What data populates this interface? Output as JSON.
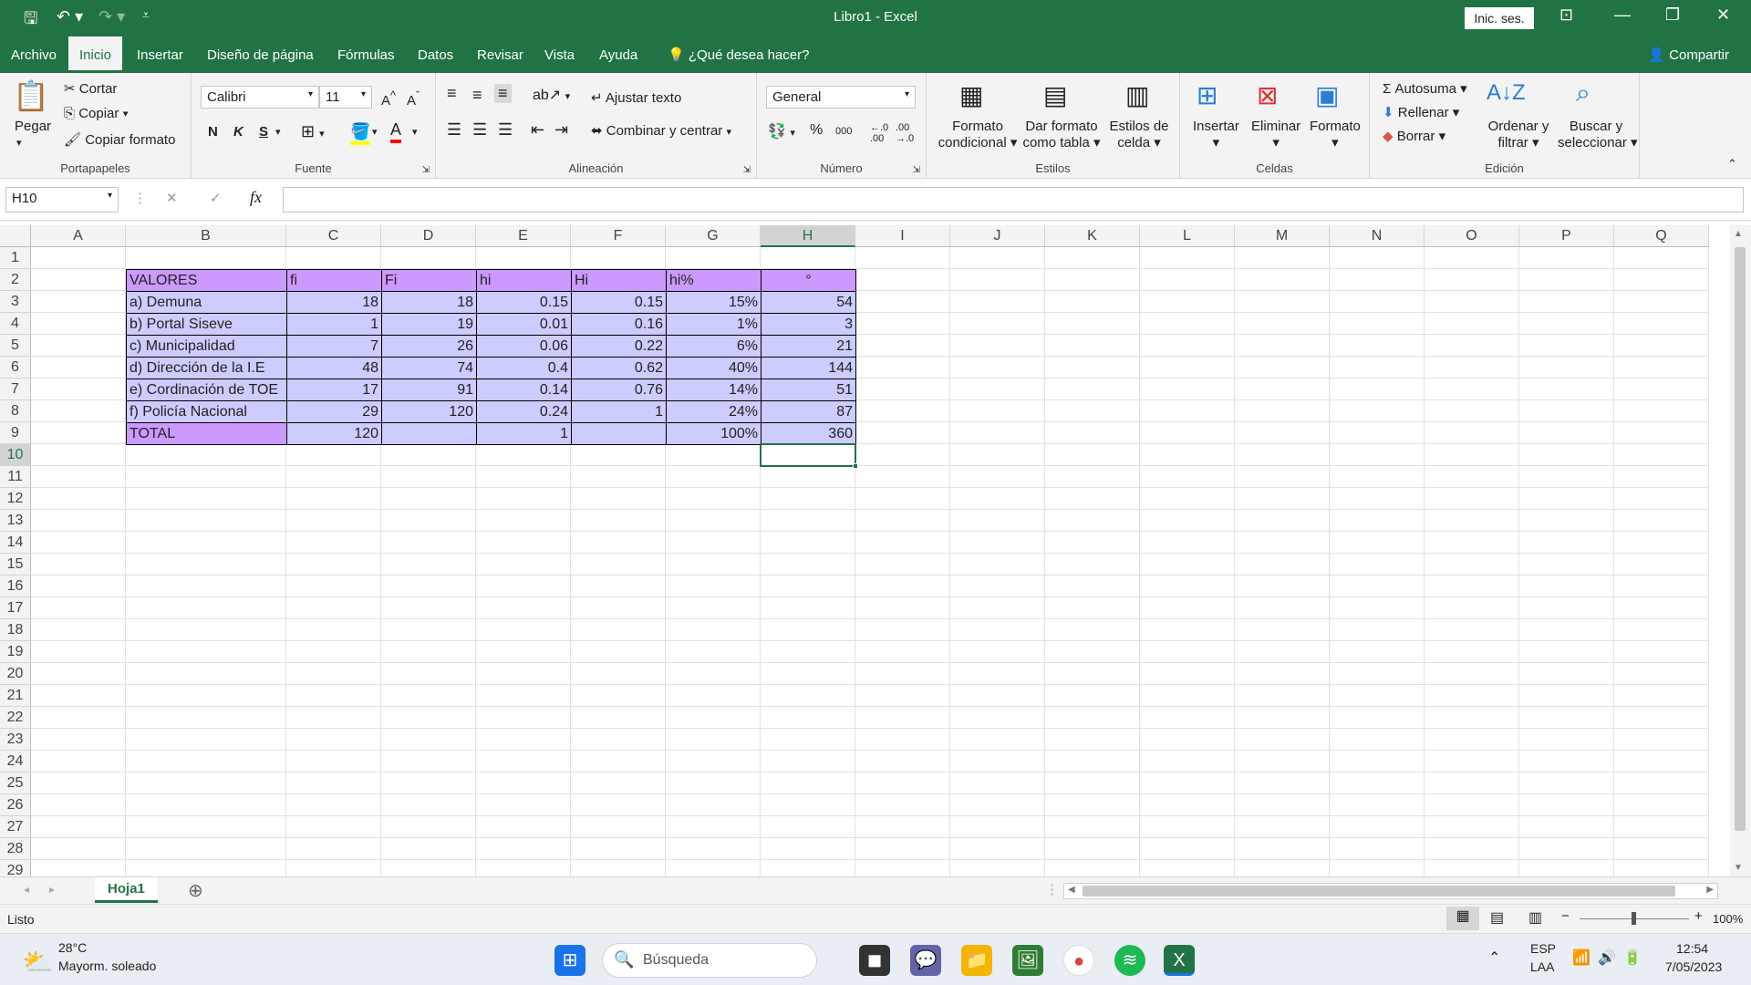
{
  "window": {
    "title": "Libro1  -  Excel",
    "signin": "Inic. ses."
  },
  "menu": {
    "tabs": [
      "Archivo",
      "Inicio",
      "Insertar",
      "Diseño de página",
      "Fórmulas",
      "Datos",
      "Revisar",
      "Vista",
      "Ayuda"
    ],
    "tell_me": "¿Qué desea hacer?",
    "share": "Compartir"
  },
  "ribbon": {
    "clipboard": {
      "paste": "Pegar",
      "cut": "Cortar",
      "copy": "Copiar",
      "format_painter": "Copiar formato",
      "label": "Portapapeles"
    },
    "font": {
      "name": "Calibri",
      "size": "11",
      "bold": "N",
      "italic": "K",
      "underline": "S",
      "label": "Fuente"
    },
    "alignment": {
      "wrap": "Ajustar texto",
      "merge": "Combinar y centrar",
      "label": "Alineación"
    },
    "number": {
      "format": "General",
      "label": "Número"
    },
    "styles": {
      "cond_1": "Formato",
      "cond_2": "condicional",
      "table_1": "Dar formato",
      "table_2": "como tabla",
      "cell_1": "Estilos de",
      "cell_2": "celda",
      "label": "Estilos"
    },
    "cells": {
      "insert": "Insertar",
      "delete": "Eliminar",
      "format": "Formato",
      "label": "Celdas"
    },
    "editing": {
      "autosum": "Autosuma",
      "fill": "Rellenar",
      "clear": "Borrar",
      "sort_1": "Ordenar y",
      "sort_2": "filtrar",
      "find_1": "Buscar y",
      "find_2": "seleccionar",
      "label": "Edición"
    }
  },
  "formula_bar": {
    "name_box": "H10",
    "fx": "fx",
    "value": ""
  },
  "sheet": {
    "columns": [
      "A",
      "B",
      "C",
      "D",
      "E",
      "F",
      "G",
      "H",
      "I",
      "J",
      "K",
      "L",
      "M",
      "N",
      "O",
      "P",
      "Q"
    ],
    "rows": [
      "1",
      "2",
      "3",
      "4",
      "5",
      "6",
      "7",
      "8",
      "9",
      "10",
      "11",
      "12",
      "13",
      "14",
      "15",
      "16",
      "17",
      "18",
      "19",
      "20",
      "21",
      "22",
      "23",
      "24",
      "25",
      "26",
      "27",
      "28",
      "29"
    ],
    "selected_cell": "H10",
    "table": {
      "header": [
        "VALORES",
        "fi",
        "Fi",
        "hi",
        "Hi",
        "hi%",
        "°"
      ],
      "rows": [
        [
          "a) Demuna",
          "18",
          "18",
          "0.15",
          "0.15",
          "15%",
          "54"
        ],
        [
          "b) Portal Siseve",
          "1",
          "19",
          "0.01",
          "0.16",
          "1%",
          "3"
        ],
        [
          "c) Municipalidad",
          "7",
          "26",
          "0.06",
          "0.22",
          "6%",
          "21"
        ],
        [
          "d) Dirección de la I.E",
          "48",
          "74",
          "0.4",
          "0.62",
          "40%",
          "144"
        ],
        [
          "e) Cordinación de TOE",
          "17",
          "91",
          "0.14",
          "0.76",
          "14%",
          "51"
        ],
        [
          "f) Policía Nacional",
          "29",
          "120",
          "0.24",
          "1",
          "24%",
          "87"
        ],
        [
          "TOTAL",
          "120",
          "",
          "1",
          "",
          "100%",
          "360"
        ]
      ],
      "header_color": "#cc99ff",
      "body_color": "#ccccff"
    },
    "tab_name": "Hoja1"
  },
  "status": {
    "ready": "Listo",
    "zoom": "100%"
  },
  "taskbar": {
    "weather_temp": "28°C",
    "weather_desc": "Mayorm. soleado",
    "search": "Búsqueda",
    "lang_1": "ESP",
    "lang_2": "LAA",
    "time": "12:54",
    "date": "7/05/2023"
  }
}
